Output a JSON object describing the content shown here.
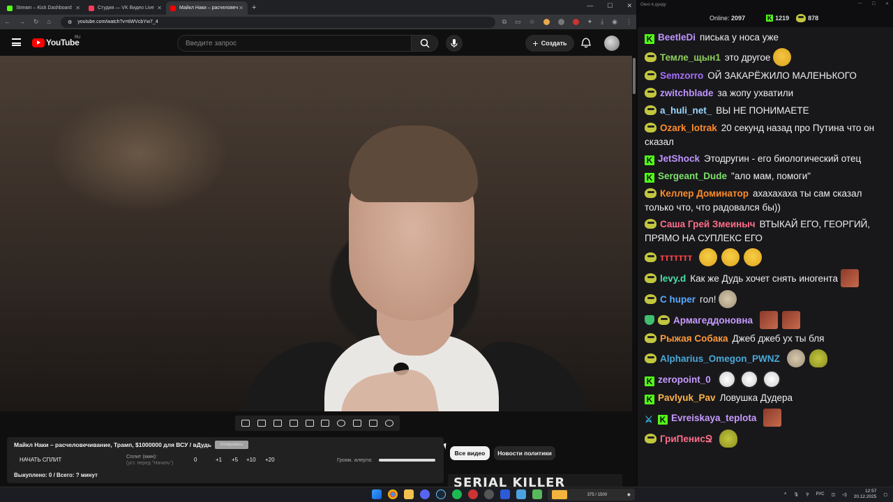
{
  "browser": {
    "tabs": [
      {
        "title": "Stream – Kick Dashboard",
        "color": "#53fc18"
      },
      {
        "title": "Студия — VK Видео Live",
        "color": "#ff3b5c"
      },
      {
        "title": "Майкл Наки – расчеловеч",
        "color": "#ff0000"
      }
    ],
    "new_tab": "+",
    "url": "youtube.com/watch?v=tiWVcbYw7_4"
  },
  "youtube": {
    "logo_text": "YouTube",
    "region": "RU",
    "search_placeholder": "Введите запрос",
    "create_label": "Создать"
  },
  "panel": {
    "title": "Майкл Наки – расчеловечивание, Трамп, $1000000 для ВСУ / вДудь",
    "copy_label": "Копировать",
    "start_split": "НАЧАТЬ СПЛИТ",
    "split_min": "Сплит (мин):",
    "split_hint": "(уст. перед \"Начать\")",
    "split_value": "0",
    "buttons": [
      "+1",
      "+5",
      "+10",
      "+20"
    ],
    "volume_label": "Громк. алерта:",
    "bought": "Выкуплено: 0 / Всего: ? минут"
  },
  "chips": [
    "Все видео",
    "Новости политики"
  ],
  "thumb_text": "SERIAL KILLER",
  "chat": {
    "window_title": "Окно в дуаду",
    "online_label": "Online:",
    "online_count": "2097",
    "kick_count": "1219",
    "other_count": "878",
    "messages": [
      {
        "badges": [
          "kick"
        ],
        "user": "BeetleDi",
        "color": "#bf94ff",
        "text": "писька у носа уже",
        "emotes": []
      },
      {
        "badges": [
          "pepe"
        ],
        "user": "Темле_щын1",
        "color": "#8fce5b",
        "text": "это другое",
        "emotes": [
          "think"
        ]
      },
      {
        "badges": [
          "pepe"
        ],
        "user": "Semzorro",
        "color": "#a970ff",
        "text": "ОЙ ЗАКАРЁЖИЛО МАЛЕНЬКОГО",
        "emotes": []
      },
      {
        "badges": [
          "pepe"
        ],
        "user": "zwitchblade",
        "color": "#bf94ff",
        "text": "за жопу ухватили",
        "emotes": []
      },
      {
        "badges": [
          "pepe"
        ],
        "user": "a_huli_net_",
        "color": "#9ad7ff",
        "text": "ВЫ НЕ ПОНИМАЕТЕ",
        "emotes": []
      },
      {
        "badges": [
          "pepe"
        ],
        "user": "Ozark_lotrak",
        "color": "#ff8c2a",
        "text": "20 секунд назад про Путина что он сказал",
        "emotes": []
      },
      {
        "badges": [
          "kick"
        ],
        "user": "JetShock",
        "color": "#bf94ff",
        "text": "Этодругин - его биологический отец",
        "emotes": []
      },
      {
        "badges": [
          "kick"
        ],
        "user": "Sergeant_Dude",
        "color": "#7ee06b",
        "text": "\"ало мам, помоги\"",
        "emotes": []
      },
      {
        "badges": [
          "pepe"
        ],
        "user": "Келлер Доминатор",
        "color": "#ff8c2a",
        "text": "ахахахаха ты сам сказал только что, что радовался бы))",
        "emotes": []
      },
      {
        "badges": [
          "pepe"
        ],
        "user": "Саша Грей Змеиныч",
        "color": "#ff6e8a",
        "text": "ВТЫКАЙ ЕГО, ГЕОРГИЙ, ПРЯМО НА СУПЛЕКС ЕГО",
        "emotes": []
      },
      {
        "badges": [
          "pepe"
        ],
        "user": "ттттттт",
        "color": "#ff4646",
        "text": "",
        "emotes": [
          "lol",
          "lol",
          "lol"
        ]
      },
      {
        "badges": [
          "pepe"
        ],
        "user": "levy.d",
        "color": "#4fe0a8",
        "text": "Как же Дудь хочет снять иногента",
        "emotes": [
          "face"
        ]
      },
      {
        "badges": [
          "pepe"
        ],
        "user": "C huper",
        "color": "#5aa9ff",
        "text": "гол!",
        "emotes": [
          "cat"
        ]
      },
      {
        "badges": [
          "shield",
          "pepe"
        ],
        "user": "Армагеддоновна",
        "color": "#c79bff",
        "text": "",
        "emotes": [
          "face",
          "face"
        ]
      },
      {
        "badges": [
          "pepe"
        ],
        "user": "Рыжая Собака",
        "color": "#ff9a3c",
        "text": "Джеб джеб ух ты бля",
        "emotes": []
      },
      {
        "badges": [
          "pepe"
        ],
        "user": "Alpharius_Omegon_PWNZ",
        "color": "#4aa8d8",
        "text": "",
        "emotes": [
          "cat",
          "frog"
        ]
      },
      {
        "badges": [
          "kick"
        ],
        "user": "zeropoint_0",
        "color": "#c79bff",
        "text": "",
        "emotes": [
          "troll",
          "troll",
          "troll"
        ]
      },
      {
        "badges": [
          "kick"
        ],
        "user": "Pavlyuk_Pav",
        "color": "#ffb347",
        "text": "Ловушка Дудера",
        "emotes": []
      },
      {
        "badges": [
          "sword",
          "kick"
        ],
        "user": "Evreiskaya_teplota",
        "color": "#c79bff",
        "text": "",
        "emotes": [
          "face"
        ]
      },
      {
        "badges": [
          "pepe"
        ],
        "user": "ГриПенисՋ",
        "color": "#ff6e8a",
        "text": "",
        "emotes": [
          "frog"
        ]
      }
    ]
  },
  "taskbar": {
    "now_playing": "375 / 1500",
    "lang": "РУС",
    "time": "12:57",
    "date": "20.12.2025"
  }
}
